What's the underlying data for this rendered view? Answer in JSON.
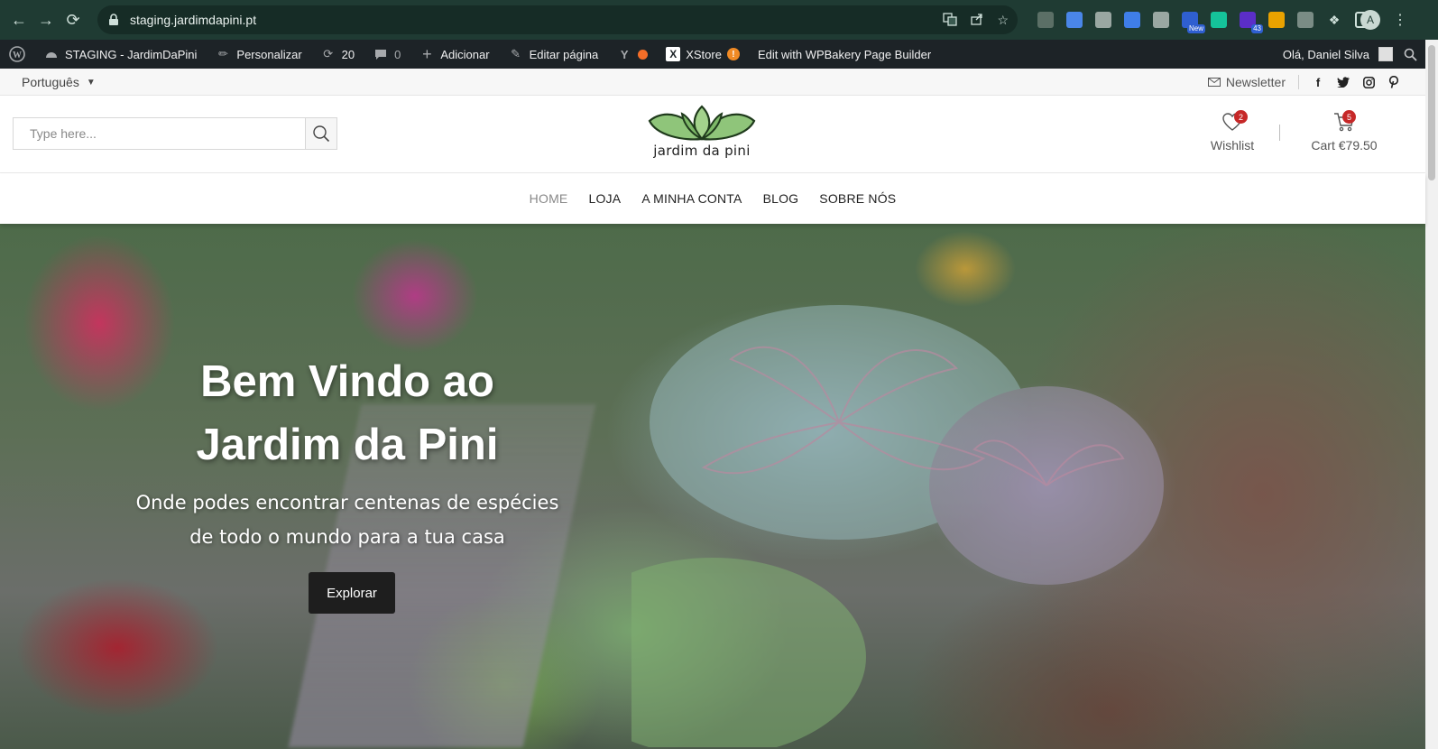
{
  "browser": {
    "url": "staging.jardimdapini.pt",
    "profile_initial": "A",
    "extensions": [
      {
        "name": "recycle-extension-icon",
        "color": "#5b6f66"
      },
      {
        "name": "docs-extension-icon",
        "color": "#4a86e8"
      },
      {
        "name": "globe-extension-icon",
        "color": "#9aa7a2"
      },
      {
        "name": "translate-extension-icon",
        "color": "#3f7ee8"
      },
      {
        "name": "camera-extension-icon",
        "color": "#9aa7a2"
      },
      {
        "name": "new-extension-icon",
        "color": "#2f5fd0",
        "badge": "New"
      },
      {
        "name": "grammarly-extension-icon",
        "color": "#15c39a"
      },
      {
        "name": "shield-extension-icon",
        "color": "#5b2ec7",
        "badge": "43"
      },
      {
        "name": "tag-extension-icon",
        "color": "#e9a200"
      },
      {
        "name": "xfilter-extension-icon",
        "color": "#7a8c85"
      }
    ]
  },
  "admin_bar": {
    "site_name": "STAGING - JardimDaPini",
    "customize": "Personalizar",
    "updates": "20",
    "comments": "0",
    "add_new": "Adicionar",
    "edit_page": "Editar página",
    "xstore": "XStore",
    "xstore_alert": "!",
    "wpbakery": "Edit with WPBakery Page Builder",
    "greeting": "Olá, Daniel Silva"
  },
  "topbar": {
    "language": "Português",
    "newsletter": "Newsletter",
    "socials": [
      "facebook-icon",
      "twitter-icon",
      "instagram-icon",
      "pinterest-icon"
    ]
  },
  "header": {
    "search_placeholder": "Type here...",
    "logo_text": "jardim da pini",
    "wishlist_label": "Wishlist",
    "wishlist_count": "2",
    "cart_label": "Cart",
    "cart_total": "€79.50",
    "cart_count": "5"
  },
  "nav": {
    "items": [
      "HOME",
      "LOJA",
      "A MINHA CONTA",
      "BLOG",
      "SOBRE NÓS"
    ],
    "active": "HOME"
  },
  "hero": {
    "title_line1": "Bem Vindo ao",
    "title_line2": "Jardim da Pini",
    "subtitle_line1": "Onde podes encontrar centenas de espécies",
    "subtitle_line2": "de todo o mundo para a tua casa",
    "button": "Explorar"
  },
  "colors": {
    "browser_bg": "#1f3b33",
    "admin_bg": "#1d2327",
    "badge": "#c62828",
    "button_bg": "#1e1e1e",
    "logo_leaf": "#8fc57a"
  }
}
